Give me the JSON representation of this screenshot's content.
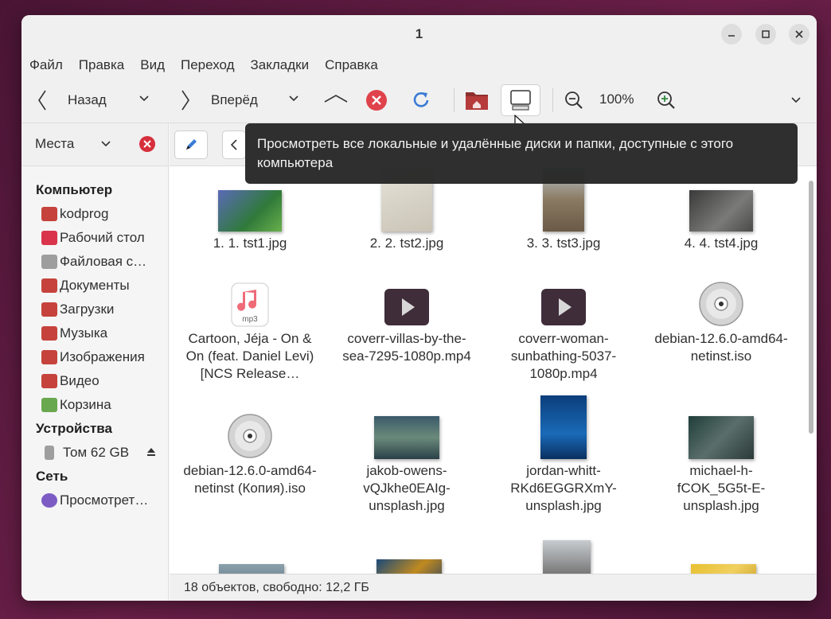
{
  "window": {
    "title": "1"
  },
  "menubar": [
    "Файл",
    "Правка",
    "Вид",
    "Переход",
    "Закладки",
    "Справка"
  ],
  "toolbar": {
    "back_label": "Назад",
    "forward_label": "Вперёд",
    "zoom_level": "100%"
  },
  "places": {
    "label": "Места"
  },
  "sidebar": {
    "sections": [
      {
        "heading": "Компьютер",
        "items": [
          {
            "label": "kodprog",
            "icon": "home-folder-icon",
            "color": "#c5433c"
          },
          {
            "label": "Рабочий стол",
            "icon": "desktop-folder-icon",
            "color": "#d9344c"
          },
          {
            "label": "Файловая с…",
            "icon": "disk-icon",
            "color": "#9e9e9e"
          },
          {
            "label": "Документы",
            "icon": "documents-folder-icon",
            "color": "#c5433c"
          },
          {
            "label": "Загрузки",
            "icon": "downloads-folder-icon",
            "color": "#c5433c"
          },
          {
            "label": "Музыка",
            "icon": "music-folder-icon",
            "color": "#c5433c"
          },
          {
            "label": "Изображения",
            "icon": "pictures-folder-icon",
            "color": "#c5433c"
          },
          {
            "label": "Видео",
            "icon": "videos-folder-icon",
            "color": "#c5433c"
          },
          {
            "label": "Корзина",
            "icon": "trash-icon",
            "color": "#6aa84f"
          }
        ]
      },
      {
        "heading": "Устройства",
        "items": [
          {
            "label": "Том 62 GB",
            "icon": "usb-drive-icon",
            "color": "#9e9e9e"
          }
        ]
      },
      {
        "heading": "Сеть",
        "items": [
          {
            "label": "Просмотрет…",
            "icon": "network-icon",
            "color": "#7c5cc4"
          }
        ]
      }
    ]
  },
  "files": [
    {
      "name": "1. 1. tst1.jpg",
      "kind": "image"
    },
    {
      "name": "2. 2. tst2.jpg",
      "kind": "image"
    },
    {
      "name": "3. 3. tst3.jpg",
      "kind": "image"
    },
    {
      "name": "4. 4. tst4.jpg",
      "kind": "image"
    },
    {
      "name": "Cartoon, Jéja - On & On (feat. Daniel Levi) [NCS Release…",
      "kind": "audio"
    },
    {
      "name": "coverr-villas-by-the-sea-7295-1080p.mp4",
      "kind": "video"
    },
    {
      "name": "coverr-woman-sunbathing-5037-1080p.mp4",
      "kind": "video"
    },
    {
      "name": "debian-12.6.0-amd64-netinst.iso",
      "kind": "disc"
    },
    {
      "name": "debian-12.6.0-amd64-netinst (Копия).iso",
      "kind": "disc"
    },
    {
      "name": "jakob-owens-vQJkhe0EAIg-unsplash.jpg",
      "kind": "image"
    },
    {
      "name": "jordan-whitt-RKd6EGGRXmY-unsplash.jpg",
      "kind": "image"
    },
    {
      "name": "michael-h-fCOK_5G5t-E-unsplash.jpg",
      "kind": "image"
    }
  ],
  "audio_badge": "mp3",
  "statusbar": "18 объектов, свободно: 12,2 ГБ",
  "tooltip": "Просмотреть все локальные и удалённые диски и папки, доступные с этого компьютера",
  "colors": {
    "accent_red": "#e0424b",
    "accent_blue": "#3a7bd5",
    "wallpaper": "#5b1a3f"
  }
}
